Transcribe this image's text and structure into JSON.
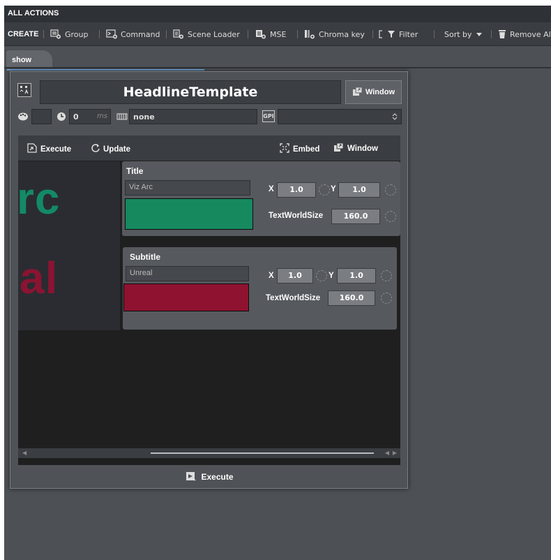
{
  "header": {
    "title": "ALL ACTIONS"
  },
  "toolbar": {
    "create": "CREATE",
    "group": "Group",
    "command": "Command",
    "scene_loader": "Scene Loader",
    "mse": "MSE",
    "chroma_key": "Chroma key",
    "filter": "Filter",
    "sort_by": "Sort by",
    "remove_all": "Remove All"
  },
  "tabs": [
    {
      "label": "show"
    }
  ],
  "template": {
    "name": "HeadlineTemplate",
    "window_label": "Window",
    "delay_value": "0",
    "delay_unit": "ms",
    "channel": "none",
    "gpi_label": "GPI",
    "gpi_value": ""
  },
  "actions": {
    "execute": "Execute",
    "update": "Update",
    "embed": "Embed",
    "window": "Window"
  },
  "preview": {
    "line1": "rc",
    "line2": "al",
    "color1": "#138a66",
    "color2": "#8a1432"
  },
  "cards": [
    {
      "title": "Title",
      "text": "Viz Arc",
      "color": "#16895f",
      "x_label": "X",
      "x": "1.0",
      "y_label": "Y",
      "y": "1.0",
      "size_label": "TextWorldSize",
      "size": "160.0"
    },
    {
      "title": "Subtitle",
      "text": "Unreal",
      "color": "#8f1230",
      "x_label": "X",
      "x": "1.0",
      "y_label": "Y",
      "y": "1.0",
      "size_label": "TextWorldSize",
      "size": "160.0"
    }
  ],
  "footer": {
    "execute": "Execute"
  }
}
